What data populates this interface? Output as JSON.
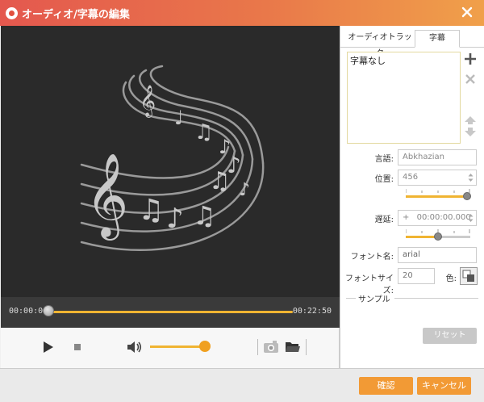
{
  "window": {
    "title": "オーディオ/字幕の編集"
  },
  "player": {
    "current_time": "00:00:00",
    "total_time": "00:22:50",
    "progress": 0.0,
    "volume": 0.95
  },
  "tabs": [
    {
      "label": "オーディオトラック",
      "active": false
    },
    {
      "label": "字幕",
      "active": true
    }
  ],
  "subtitles": {
    "items": [
      "字幕なし"
    ],
    "language_label": "言語:",
    "language_value": "Abkhazian",
    "position_label": "位置:",
    "position_value": "456",
    "position_level": 0.95,
    "delay_label": "遅延:",
    "delay_sign": "+",
    "delay_value": "00:00:00.000",
    "delay_level": 0.5,
    "font_name_label": "フォント名:",
    "font_name_value": "arial",
    "font_size_label": "フォントサイズ:",
    "font_size_value": "20",
    "color_label": "色:",
    "sample_label": "サンプル",
    "reset_label": "リセット"
  },
  "footer": {
    "ok_label": "確認",
    "cancel_label": "キャンセル"
  },
  "icons": {
    "app": "app-logo-icon",
    "close": "close-icon",
    "play": "play-icon",
    "stop": "stop-icon",
    "volume": "volume-icon",
    "snapshot": "camera-icon",
    "folder": "folder-icon",
    "add": "plus-icon",
    "remove": "x-icon",
    "up": "arrow-up-icon",
    "down": "arrow-down-icon"
  },
  "colors": {
    "accent": "#f0b432",
    "button": "#f29a35",
    "title_start": "#e4584e",
    "title_end": "#f0a04a"
  }
}
